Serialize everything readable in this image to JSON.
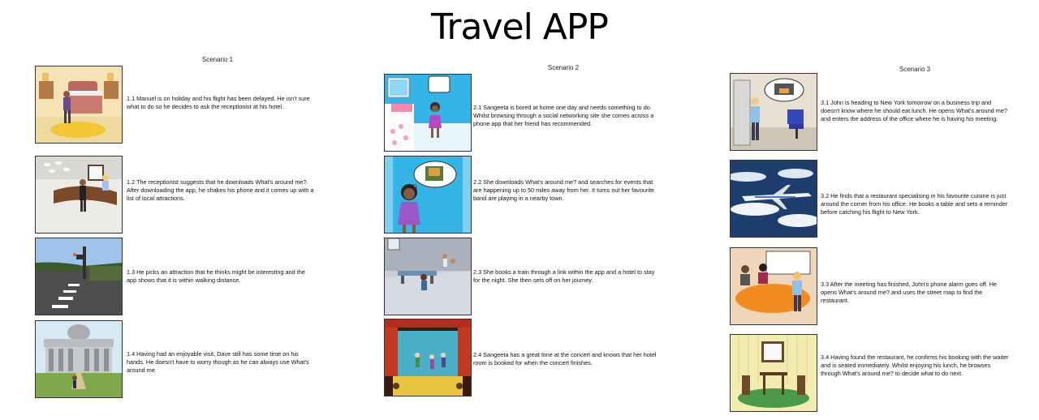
{
  "title": "Travel APP",
  "scenarios": [
    {
      "name": "Scenario 1",
      "frames": [
        {
          "text": "1.1 Manuel is on holiday and his flight has been delayed. He isn't sure what to do so he decides to ask the receptionist at his hotel.",
          "image": "hotel-room-illustration"
        },
        {
          "text": "1.2 The receptionist suggests that he downloads What's around me?. After downloading the app, he shakes his phone and it comes up with a list of local attractions.",
          "image": "hotel-reception-illustration"
        },
        {
          "text": "1.3 He picks an attraction that he thinks might be interesting and the app shows that it is within walking distance.",
          "image": "street-crossing-illustration"
        },
        {
          "text": "1.4 Having had an enjoyable visit, Dave still has some time on his hands. He doesn't have to worry though as he can always use What's around me.",
          "image": "museum-illustration"
        }
      ]
    },
    {
      "name": "Scenario 2",
      "frames": [
        {
          "text": "2.1 Sangeeta is bored at home one day and needs something to do. Whilst browsing through a social networking site she comes across a phone app that her friend has recommended.",
          "image": "bedroom-illustration"
        },
        {
          "text": "2.2 She downloads What's around me? and searches for events that are happening up to 50 miles away from her. It turns out her favourite band are playing in a nearby town.",
          "image": "girl-thinking-illustration"
        },
        {
          "text": "2.3 She books a train through a link within the app and a hotel to stay for the night. She then sets off on her journey.",
          "image": "train-station-illustration"
        },
        {
          "text": "2.4 Sangeeta has a great time at the concert and knows that her hotel room is booked for when the concert finishes.",
          "image": "concert-stage-illustration"
        }
      ]
    },
    {
      "name": "Scenario 3",
      "frames": [
        {
          "text": "3.1 John is heading to New York tomorrow on a business trip and doesn't know where he should eat lunch. He opens What's around me? and enters the address of the office where he is having his meeting.",
          "image": "office-illustration"
        },
        {
          "text": "3.2 He finds that a restaurant specialising in his favourite cuisine is just around the corner from his office. He books a table and sets a reminder before catching his flight to New York.",
          "image": "airplane-illustration"
        },
        {
          "text": "3.3 After the meeting has finished, John's phone alarm goes off. He opens What's around me? and uses the street map to find the restaurant.",
          "image": "meeting-room-illustration"
        },
        {
          "text": "3.4 Having found the restaurant, he confirms his booking with the waiter and is seated immediately. Whilst enjoying his lunch, he browses through What's around me? to decide what to do next.",
          "image": "restaurant-illustration"
        }
      ]
    }
  ]
}
